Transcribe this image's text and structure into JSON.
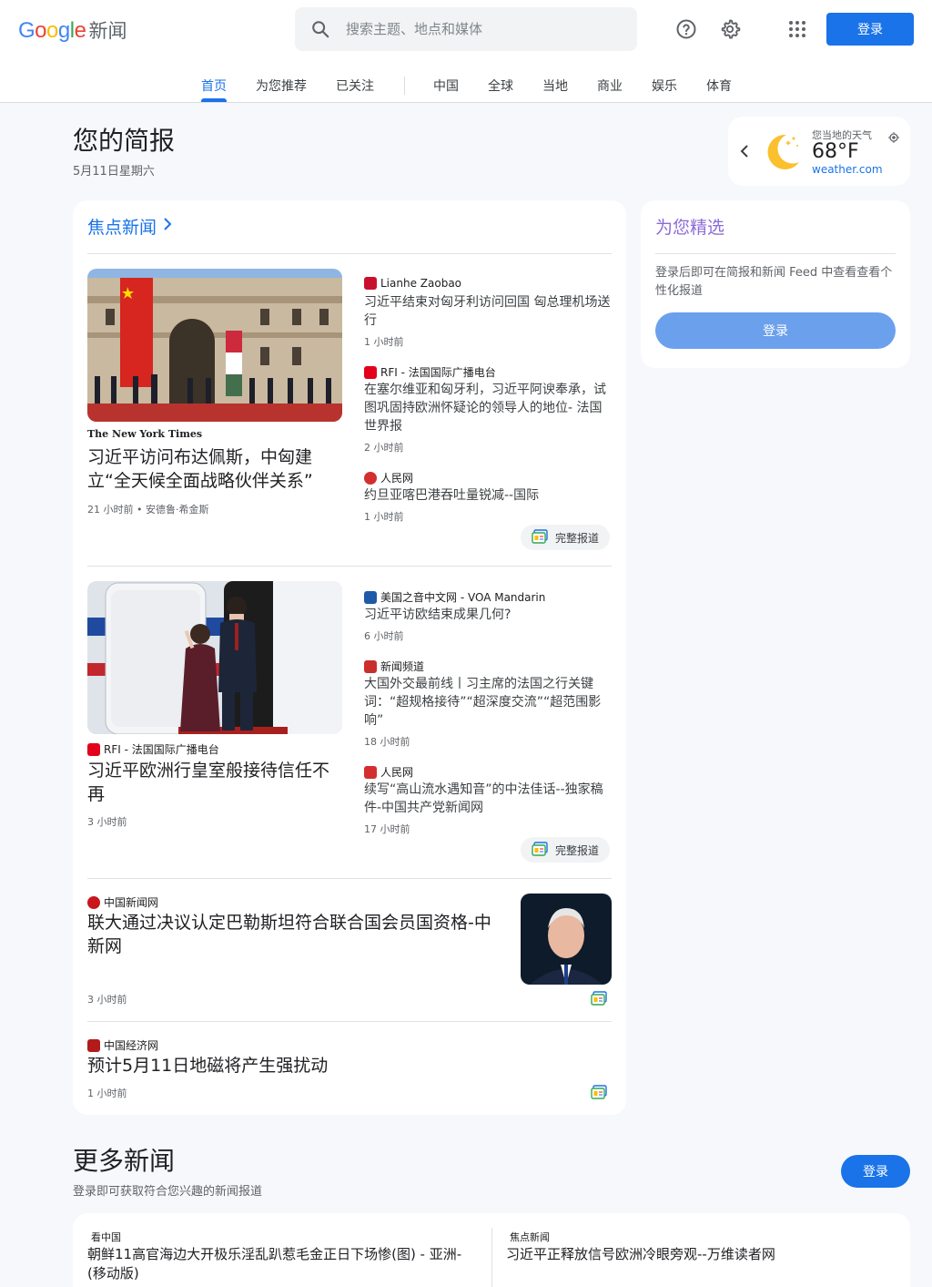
{
  "header": {
    "logo_google": [
      "G",
      "o",
      "o",
      "g",
      "l",
      "e"
    ],
    "logo_news": "新闻",
    "search_placeholder": "搜索主题、地点和媒体",
    "login": "登录"
  },
  "tabs": [
    "首页",
    "为您推荐",
    "已关注",
    "中国",
    "全球",
    "当地",
    "商业",
    "娱乐",
    "体育"
  ],
  "briefing": {
    "title": "您的简报",
    "date": "5月11日星期六"
  },
  "weather": {
    "label": "您当地的天气",
    "temp": "68°F",
    "source": "weather.com"
  },
  "headlines": {
    "title": "焦点新闻",
    "full_coverage": "完整报道",
    "story1": {
      "main_source": "The New York Times",
      "main_title": "习近平访问布达佩斯，中匈建立“全天候全面战略伙伴关系”",
      "main_time": "21 小时前 • 安德鲁·希金斯",
      "items": [
        {
          "source": "Lianhe Zaobao",
          "title": "习近平结束对匈牙利访问回国 匈总理机场送行",
          "time": "1 小时前"
        },
        {
          "source": "RFI - 法国国际广播电台",
          "title": "在塞尔维亚和匈牙利，习近平阿谀奉承，试图巩固持欧洲怀疑论的领导人的地位- 法国世界报",
          "time": "2 小时前"
        },
        {
          "source": "人民网",
          "title": "约旦亚喀巴港吞吐量锐减--国际",
          "time": "1 小时前"
        }
      ]
    },
    "story2": {
      "main_source": "RFI - 法国国际广播电台",
      "main_title": "习近平欧洲行皇室般接待信任不再",
      "main_time": "3 小时前",
      "items": [
        {
          "source": "美国之音中文网 - VOA Mandarin",
          "title": "习近平访欧结束成果几何?",
          "time": "6 小时前"
        },
        {
          "source": "新闻频道",
          "title": "大国外交最前线丨习主席的法国之行关键词：“超规格接待”“超深度交流”“超范围影响”",
          "time": "18 小时前"
        },
        {
          "source": "人民网",
          "title": "续写“高山流水遇知音”的中法佳话--独家稿件-中国共产党新闻网",
          "time": "17 小时前"
        }
      ]
    },
    "story3": {
      "source": "中国新闻网",
      "title": "联大通过决议认定巴勒斯坦符合联合国会员国资格-中新网",
      "time": "3 小时前"
    },
    "story4": {
      "source": "中国经济网",
      "title": "预计5月11日地磁将产生强扰动",
      "time": "1 小时前"
    }
  },
  "picks": {
    "title": "为您精选",
    "text": "登录后即可在简报和新闻 Feed 中查看查看个性化报道",
    "button": "登录"
  },
  "more": {
    "title": "更多新闻",
    "subtitle": "登录即可获取符合您兴趣的新闻报道",
    "button": "登录",
    "items": [
      {
        "tag": "看中国",
        "title": "朝鲜11高官海边大开极乐淫乱趴惹毛金正日下场惨(图) - 亚洲- (移动版)"
      },
      {
        "tag": "焦点新闻",
        "title": "习近平正释放信号欧洲冷眼旁观--万维读者网"
      }
    ]
  },
  "colors": {
    "accent": "#1a73e8",
    "picks_title": "#8c6bd6",
    "picks_button": "#6ba0ed"
  }
}
